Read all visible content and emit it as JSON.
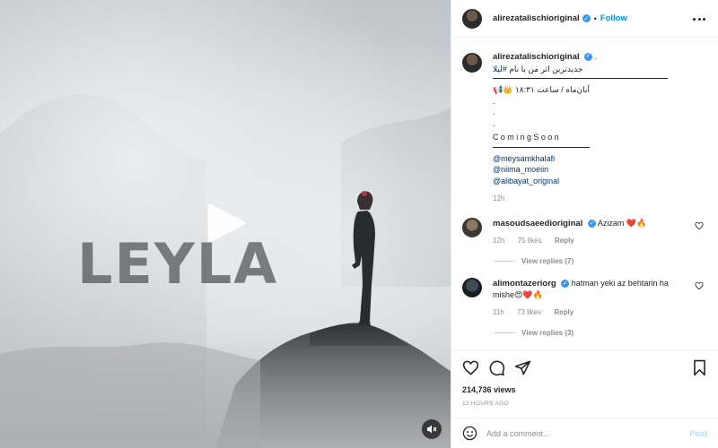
{
  "media": {
    "overlay_title": "LEYLA"
  },
  "post": {
    "username": "alirezatalischioriginal",
    "verified_mark": "✓",
    "separator": "•",
    "follow_label": "Follow"
  },
  "caption": {
    "username": "alirezatalischioriginal",
    "text_line1": "جدیدترین اثر من با نام",
    "hashtag": "#لیلا",
    "date_line": "آبان‌ماه / ساعت ۱۸:۳۱",
    "date_emojis": "👑📢",
    "dot1": ".",
    "dot2": ".",
    "dot3": ".",
    "coming_soon": "ComingSoon",
    "mentions": [
      "@meysamkhalafi",
      "@niima_moeiin",
      "@alibayat_original"
    ],
    "time": "12h"
  },
  "comments": [
    {
      "username": "masoudsaeedioriginal",
      "text": "Azizam ❤️🔥",
      "time": "12h",
      "likes": "75 likes",
      "reply_label": "Reply",
      "view_replies": "View replies (7)"
    },
    {
      "username": "alimontazeriorg",
      "text": "hatman yeki az behtarin ha mishe😍❤️🔥",
      "time": "11h",
      "likes": "73 likes",
      "reply_label": "Reply",
      "view_replies": "View replies (3)"
    }
  ],
  "stats": {
    "views": "214,736 views",
    "posted": "12 HOURS AGO"
  },
  "add_comment": {
    "placeholder": "Add a comment…",
    "post_label": "Post"
  },
  "icons": {
    "like": "heart-icon",
    "comment": "comment-icon",
    "share": "share-icon",
    "save": "bookmark-icon",
    "emoji": "emoji-icon",
    "more": "more-options-icon",
    "play": "play-icon",
    "mute": "mute-icon"
  },
  "colors": {
    "link": "#00376b",
    "follow": "#0095f6",
    "verified": "#3897f0",
    "muted": "#8e8e8e",
    "post_disabled": "#b2dffc"
  }
}
